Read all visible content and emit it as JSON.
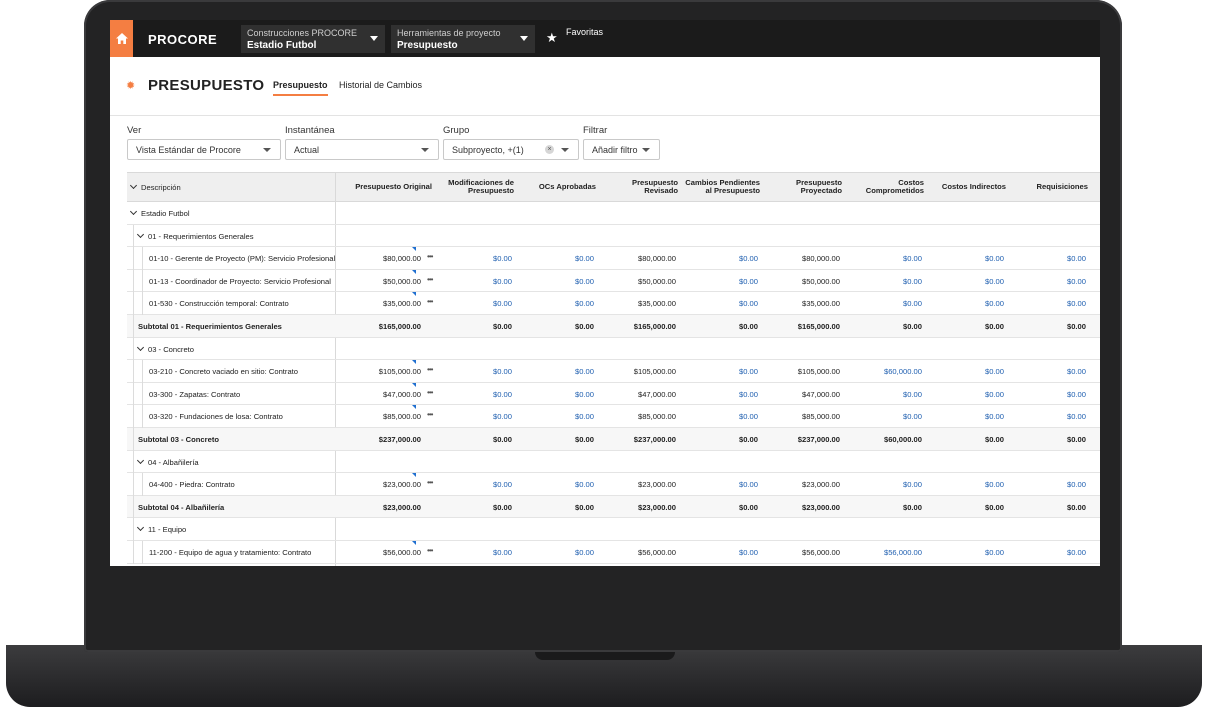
{
  "topbar": {
    "logo": "PROCORE",
    "project_company": "Construcciones PROCORE",
    "project_name": "Estadio Futbol",
    "tools_label": "Herramientas de proyecto",
    "tools_value": "Presupuesto",
    "favorites": "Favoritas"
  },
  "page": {
    "title": "PRESUPUESTO",
    "tabs": [
      "Presupuesto",
      "Historial de Cambios"
    ]
  },
  "filters": {
    "ver_label": "Ver",
    "ver_value": "Vista Estándar de Procore",
    "snapshot_label": "Instantánea",
    "snapshot_value": "Actual",
    "group_label": "Grupo",
    "group_value": "Subproyecto, +(1)",
    "filter_label": "Filtrar",
    "filter_value": "Añadir filtro"
  },
  "table": {
    "desc_header": "Descripción",
    "columns": [
      "Presupuesto Original",
      "Modificaciones de Presupuesto",
      "OCs Aprobadas",
      "Presupuesto Revisado",
      "Cambios Pendientes al Presupuesto",
      "Presupuesto Proyectado",
      "Costos Comprometidos",
      "Costos Indirectos",
      "Requisiciones"
    ],
    "rows": [
      {
        "kind": "group0",
        "label": "Estadio Futbol"
      },
      {
        "kind": "group1",
        "label": "01 - Requerimientos Generales"
      },
      {
        "kind": "item",
        "label": "01-10 - Gerente de Proyecto (PM): Servicio Profesional",
        "values": [
          "$80,000.00",
          "$0.00",
          "$0.00",
          "$80,000.00",
          "$0.00",
          "$80,000.00",
          "$0.00",
          "$0.00",
          "$0.00"
        ]
      },
      {
        "kind": "item",
        "label": "01-13 - Coordinador de Proyecto: Servicio Profesional",
        "values": [
          "$50,000.00",
          "$0.00",
          "$0.00",
          "$50,000.00",
          "$0.00",
          "$50,000.00",
          "$0.00",
          "$0.00",
          "$0.00"
        ]
      },
      {
        "kind": "item",
        "label": "01-530 - Construcción temporal: Contrato",
        "values": [
          "$35,000.00",
          "$0.00",
          "$0.00",
          "$35,000.00",
          "$0.00",
          "$35,000.00",
          "$0.00",
          "$0.00",
          "$0.00"
        ]
      },
      {
        "kind": "subtotal",
        "label": "Subtotal 01 - Requerimientos Generales",
        "values": [
          "$165,000.00",
          "$0.00",
          "$0.00",
          "$165,000.00",
          "$0.00",
          "$165,000.00",
          "$0.00",
          "$0.00",
          "$0.00"
        ]
      },
      {
        "kind": "group1",
        "label": "03 - Concreto"
      },
      {
        "kind": "item",
        "label": "03-210 - Concreto vaciado en sitio: Contrato",
        "values": [
          "$105,000.00",
          "$0.00",
          "$0.00",
          "$105,000.00",
          "$0.00",
          "$105,000.00",
          "$60,000.00",
          "$0.00",
          "$0.00"
        ]
      },
      {
        "kind": "item",
        "label": "03-300 - Zapatas: Contrato",
        "values": [
          "$47,000.00",
          "$0.00",
          "$0.00",
          "$47,000.00",
          "$0.00",
          "$47,000.00",
          "$0.00",
          "$0.00",
          "$0.00"
        ]
      },
      {
        "kind": "item",
        "label": "03-320 - Fundaciones de losa: Contrato",
        "values": [
          "$85,000.00",
          "$0.00",
          "$0.00",
          "$85,000.00",
          "$0.00",
          "$85,000.00",
          "$0.00",
          "$0.00",
          "$0.00"
        ]
      },
      {
        "kind": "subtotal",
        "label": "Subtotal 03 - Concreto",
        "values": [
          "$237,000.00",
          "$0.00",
          "$0.00",
          "$237,000.00",
          "$0.00",
          "$237,000.00",
          "$60,000.00",
          "$0.00",
          "$0.00"
        ]
      },
      {
        "kind": "group1",
        "label": "04 - Albañilería"
      },
      {
        "kind": "item",
        "label": "04-400 - Piedra: Contrato",
        "values": [
          "$23,000.00",
          "$0.00",
          "$0.00",
          "$23,000.00",
          "$0.00",
          "$23,000.00",
          "$0.00",
          "$0.00",
          "$0.00"
        ]
      },
      {
        "kind": "subtotal",
        "label": "Subtotal 04 - Albañilería",
        "values": [
          "$23,000.00",
          "$0.00",
          "$0.00",
          "$23,000.00",
          "$0.00",
          "$23,000.00",
          "$0.00",
          "$0.00",
          "$0.00"
        ]
      },
      {
        "kind": "group1",
        "label": "11 - Equipo"
      },
      {
        "kind": "item",
        "label": "11-200 - Equipo de agua y tratamiento: Contrato",
        "values": [
          "$56,000.00",
          "$0.00",
          "$0.00",
          "$56,000.00",
          "$0.00",
          "$56,000.00",
          "$56,000.00",
          "$0.00",
          "$0.00"
        ]
      }
    ]
  },
  "colors": {
    "accent": "#f47e42",
    "link_blue": "#1f5fb0",
    "topbar": "#1b1b1b"
  }
}
